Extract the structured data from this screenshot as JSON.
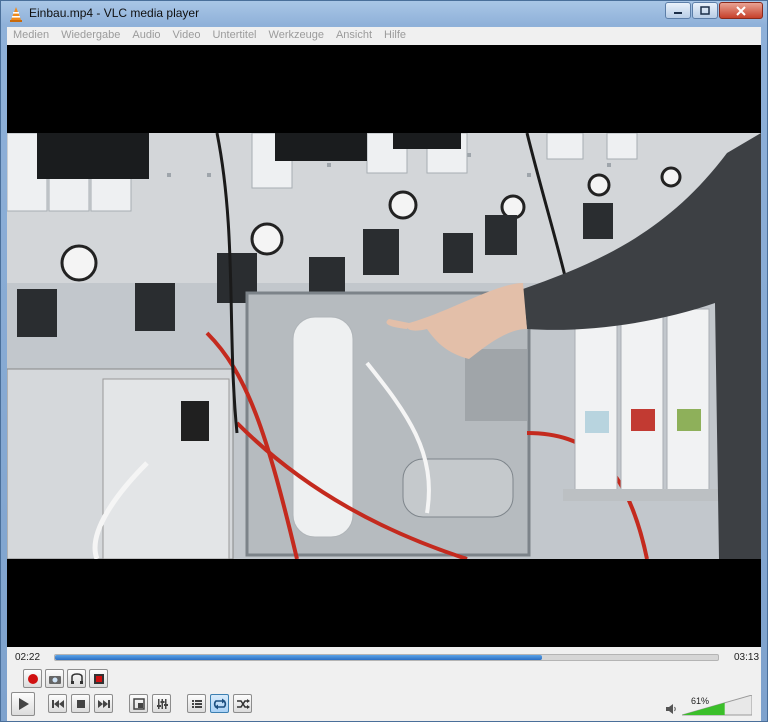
{
  "window": {
    "title": "Einbau.mp4 - VLC media player"
  },
  "menu": {
    "items": [
      "Medien",
      "Wiedergabe",
      "Audio",
      "Video",
      "Untertitel",
      "Werkzeuge",
      "Ansicht",
      "Hilfe"
    ]
  },
  "playback": {
    "elapsed": "02:22",
    "total": "03:13",
    "progress": 0.735
  },
  "volume": {
    "label": "61%",
    "level": 0.61
  },
  "colors": {
    "seek": "#2a6fc4",
    "volume": "#3bbf2a",
    "record": "#d01010"
  },
  "icons": [
    "record-icon",
    "snapshot-icon",
    "loop-ab-icon",
    "frame-step-icon",
    "play-icon",
    "previous-icon",
    "stop-icon",
    "next-icon",
    "fullscreen-icon",
    "extended-settings-icon",
    "playlist-icon",
    "loop-icon",
    "shuffle-icon",
    "speaker-icon"
  ]
}
